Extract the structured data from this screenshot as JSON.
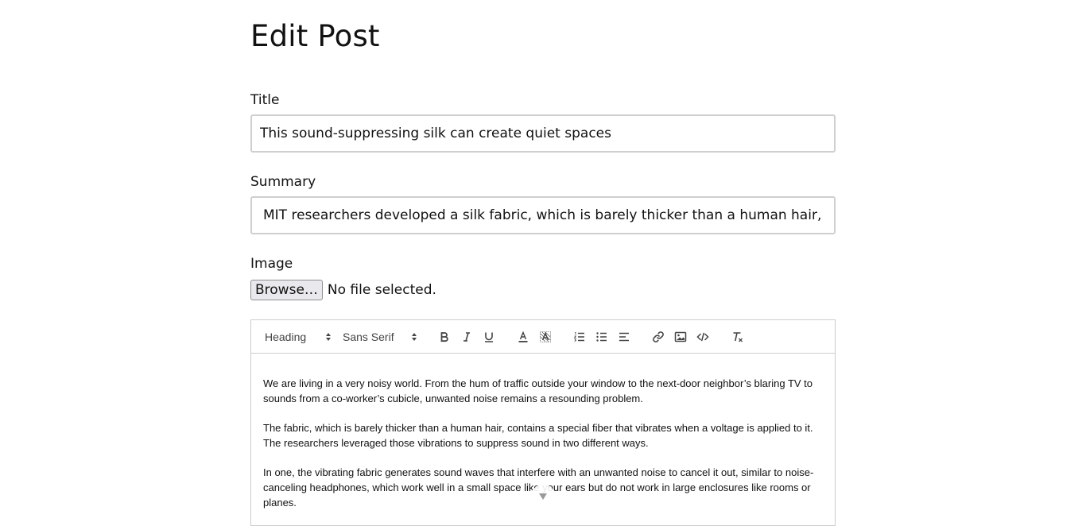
{
  "page": {
    "title": "Edit Post"
  },
  "form": {
    "title_label": "Title",
    "title_value": "This sound-suppressing silk can create quiet spaces",
    "summary_label": "Summary",
    "summary_value": "MIT researchers developed a silk fabric, which is barely thicker than a human hair, that can",
    "image_label": "Image",
    "browse_label": "Browse…",
    "file_status": "No file selected."
  },
  "editor": {
    "toolbar": {
      "header_select": "Heading",
      "font_select": "Sans Serif",
      "buttons": [
        "bold-icon",
        "italic-icon",
        "underline-icon",
        "text-color-icon",
        "highlight-icon",
        "ordered-list-icon",
        "bullet-list-icon",
        "align-icon",
        "link-icon",
        "image-icon",
        "code-icon",
        "clear-format-icon"
      ]
    },
    "paragraphs": [
      "We are living in a very noisy world. From the hum of traffic outside your window to the next-door neighbor’s blaring TV to sounds from a co-worker’s cubicle, unwanted noise remains a resounding problem.",
      "The fabric, which is barely thicker than a human hair, contains a special fiber that vibrates when a voltage is applied to it. The researchers leveraged those vibrations to suppress sound in two different ways.",
      "In one, the vibrating fabric generates sound waves that interfere with an unwanted noise to cancel it out, similar to noise-canceling headphones, which work well in a small space like your ears but do not work in large enclosures like rooms or planes."
    ]
  },
  "colors": {
    "border": "#cccccc",
    "input_border": "#cfcfcf",
    "button_bg": "#e9e9ed",
    "text": "#111111"
  }
}
